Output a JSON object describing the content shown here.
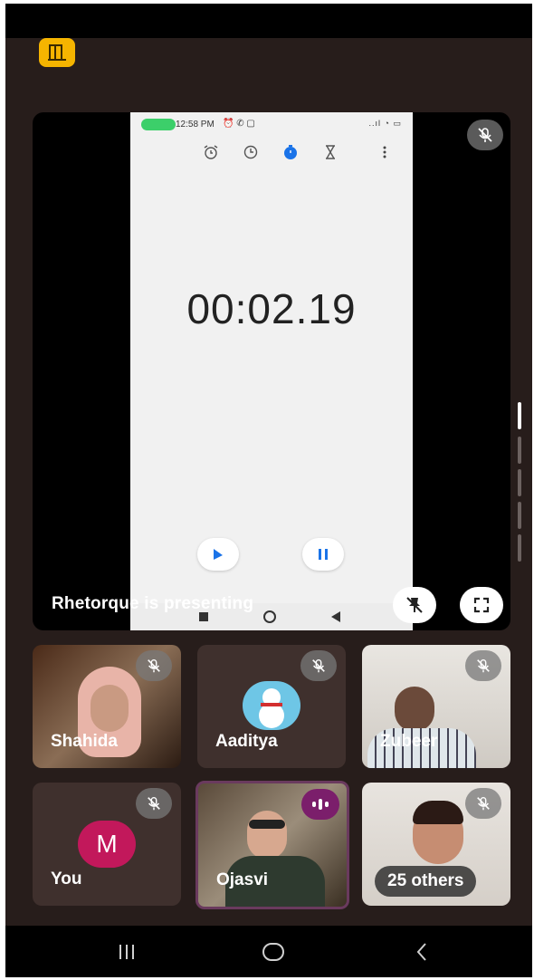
{
  "app_badge_icon": "exit-door-icon",
  "shared_screen": {
    "status_time": "12:58 PM",
    "status_icons": "⏰ ✆ ▢",
    "signal_icons": "..ıl ◔ ▭",
    "tabs": [
      "alarm-icon",
      "clock-icon",
      "stopwatch-icon",
      "timer-icon",
      "more-icon"
    ],
    "stopwatch_time": "00:02.19"
  },
  "stage": {
    "presenting_text": "Rhetorque is presenting",
    "mic_status": "muted",
    "pin_icon": "unpin-icon",
    "fullscreen_icon": "fullscreen-icon"
  },
  "participants": [
    {
      "name": "Shahida",
      "muted": true
    },
    {
      "name": "Aaditya",
      "muted": true
    },
    {
      "name": "Zubeer",
      "muted": true
    },
    {
      "name": "You",
      "initial": "M",
      "avatar_color": "#c2185b",
      "muted": true
    },
    {
      "name": "Ojasvi",
      "speaking": true
    },
    {
      "name": "25 others",
      "muted": true
    }
  ],
  "nav": [
    "recent-apps-icon",
    "home-icon",
    "back-icon"
  ]
}
